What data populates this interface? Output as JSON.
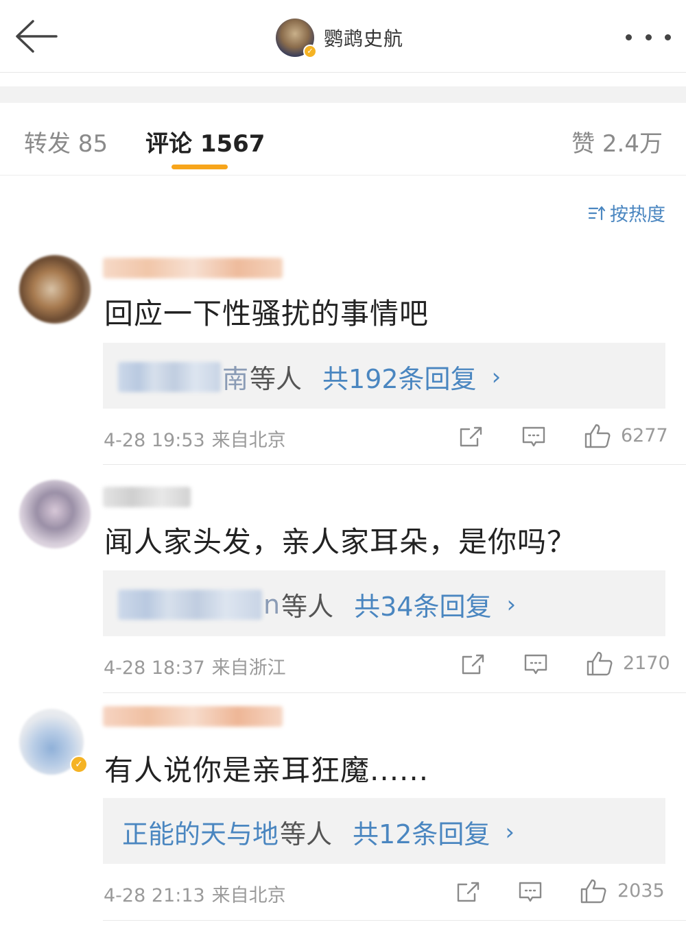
{
  "header": {
    "title": "鹦鹉史航",
    "back_icon": "back-arrow-icon",
    "more_icon": "more-dots-icon",
    "verified_mark": "✓"
  },
  "tabs": {
    "repost": "转发 85",
    "comments": "评论 1567",
    "likes": "赞 2.4万"
  },
  "sort": {
    "label": "按热度"
  },
  "comments": [
    {
      "text": "回应一下性骚扰的事情吧",
      "reply_names_tail": "南",
      "reply_etal": "等人",
      "reply_count": "共192条回复",
      "reply_chevron": "›",
      "time": "4-28 19:53",
      "location": "来自北京",
      "likes": "6277"
    },
    {
      "text": "闻人家头发，亲人家耳朵，是你吗？",
      "reply_names_tail": "n",
      "reply_etal": "等人",
      "reply_count": "共34条回复",
      "reply_chevron": "›",
      "time": "4-28 18:37",
      "location": "来自浙江",
      "likes": "2170"
    },
    {
      "text": "有人说你是亲耳狂魔......",
      "reply_names": "正能的天与地",
      "reply_etal": "等人",
      "reply_count": "共12条回复",
      "reply_chevron": "›",
      "time": "4-28 21:13",
      "location": "来自北京",
      "likes": "2035"
    }
  ],
  "colors": {
    "accent": "#f7a51b",
    "link": "#4a86c0",
    "reply_bg": "#f2f2f2",
    "meta": "#9a9a9a"
  }
}
